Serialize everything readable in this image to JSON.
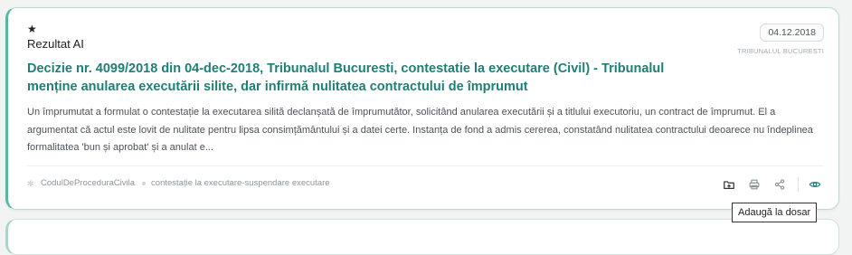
{
  "card": {
    "ai_label": "Rezultat AI",
    "date": "04.12.2018",
    "court": "TRIBUNALUL BUCURESTI",
    "title": "Decizie nr. 4099/2018 din 04-dec-2018, Tribunalul Bucuresti, contestatie la executare (Civil) - Tribunalul menține anularea executării silite, dar infirmă nulitatea contractului de împrumut",
    "summary": "Un împrumutat a formulat o contestație la executarea silită declanșată de împrumutător, solicitând anularea executării și a titlului executoriu, un contract de împrumut. El a argumentat că actul este lovit de nulitate pentru lipsa consimțământului și a datei certe. Instanța de fond a admis cererea, constatând nulitatea contractului deoarece nu îndeplinea formalitatea 'bun și aprobat' și a anulat e...",
    "tags": [
      "CodulDeProceduraCivila",
      "contestație la executare-suspendare executare"
    ],
    "icons": {
      "star": "star-icon",
      "tag": "gear-icon",
      "add_to_folder": "folder-plus-icon",
      "print": "printer-icon",
      "share": "share-icon",
      "view": "eye-icon"
    },
    "accent_color": "#1f7f74"
  },
  "tooltip": "Adaugă la dosar"
}
